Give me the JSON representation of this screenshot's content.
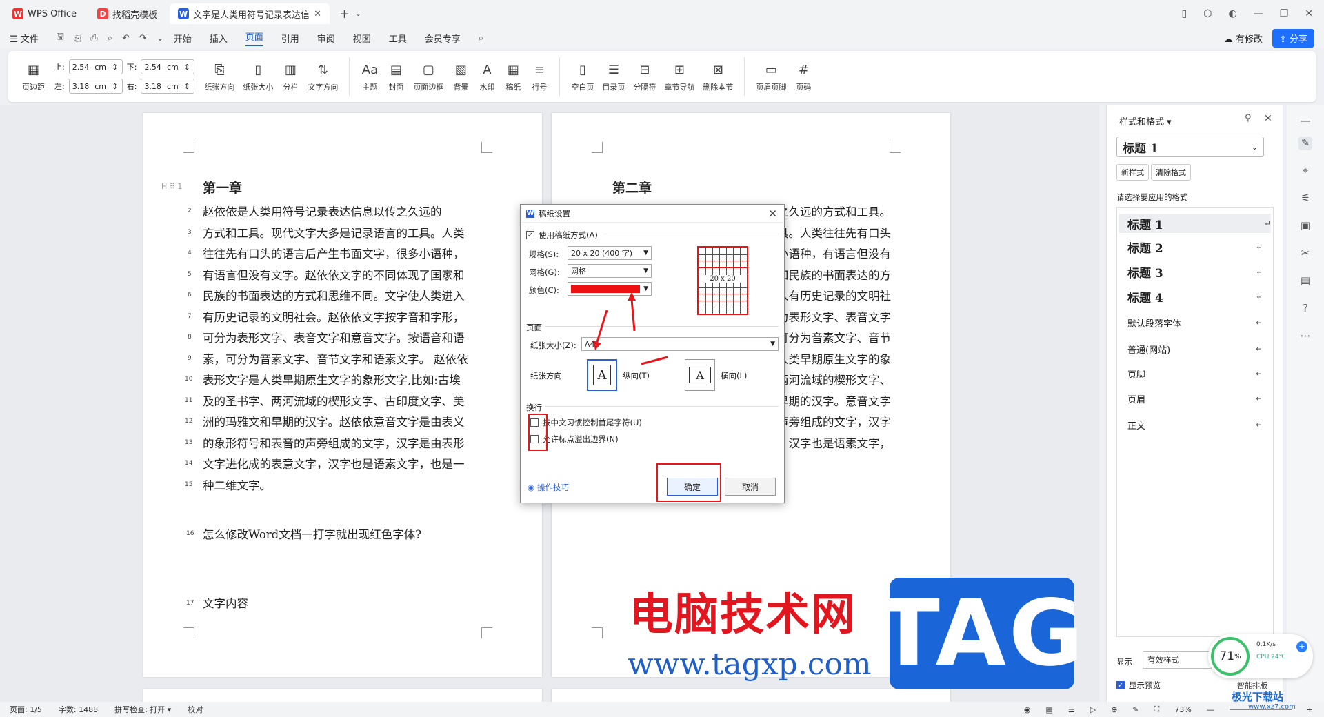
{
  "titlebar": {
    "tabs": [
      {
        "label": "WPS Office",
        "logo": "W"
      },
      {
        "label": "找稻壳模板",
        "logo": "D"
      },
      {
        "label": "文字是人类用符号记录表达信息以",
        "logo": "W"
      }
    ],
    "add_tab": "+"
  },
  "menubar": {
    "file": "☰ 文件",
    "items": [
      "开始",
      "插入",
      "页面",
      "引用",
      "审阅",
      "视图",
      "工具",
      "会员专享"
    ],
    "active": "页面",
    "modified": "有修改",
    "share": "分享"
  },
  "ribbon": {
    "page_margin": "页边距",
    "margin_top_label": "上:",
    "margin_top": "2.54",
    "margin_bottom_label": "下:",
    "margin_bottom": "2.54",
    "margin_left_label": "左:",
    "margin_left": "3.18",
    "margin_right_label": "右:",
    "margin_right": "3.18",
    "unit": "cm",
    "groups1": [
      "纸张方向",
      "纸张大小",
      "分栏",
      "文字方向"
    ],
    "groups2": [
      "主题",
      "封面",
      "页面边框",
      "背景",
      "水印",
      "稿纸",
      "行号"
    ],
    "groups3": [
      "空白页",
      "目录页",
      "分隔符",
      "章节导航",
      "删除本节"
    ],
    "groups4": [
      "页眉页脚",
      "页码"
    ]
  },
  "page1": {
    "heading": "第一章",
    "lines": [
      {
        "n": "2",
        "t": "    赵依依是人类用符号记录表达信息以传之久远的"
      },
      {
        "n": "3",
        "t": "方式和工具。现代文字大多是记录语言的工具。人类"
      },
      {
        "n": "4",
        "t": "往往先有口头的语言后产生书面文字，很多小语种，"
      },
      {
        "n": "5",
        "t": "有语言但没有文字。赵依依文字的不同体现了国家和"
      },
      {
        "n": "6",
        "t": "民族的书面表达的方式和思维不同。文字使人类进入"
      },
      {
        "n": "7",
        "t": "有历史记录的文明社会。赵依依文字按字音和字形，"
      },
      {
        "n": "8",
        "t": "可分为表形文字、表音文字和意音文字。按语音和语"
      },
      {
        "n": "9",
        "t": "素，可分为音素文字、音节文字和语素文字。 赵依依"
      },
      {
        "n": "10",
        "t": "表形文字是人类早期原生文字的象形文字,比如:古埃"
      },
      {
        "n": "11",
        "t": "及的圣书字、两河流域的楔形文字、古印度文字、美"
      },
      {
        "n": "12",
        "t": "洲的玛雅文和早期的汉字。赵依依意音文字是由表义"
      },
      {
        "n": "13",
        "t": "的象形符号和表音的声旁组成的文字，汉字是由表形"
      },
      {
        "n": "14",
        "t": "文字进化成的表意文字，汉字也是语素文字，也是一"
      },
      {
        "n": "15",
        "t": "种二维文字。"
      }
    ],
    "line16": "    怎么修改Word文档一打字就出现红色字体?",
    "line17": "文字内容"
  },
  "page2": {
    "heading": "第二章",
    "lines": [
      "传之久远的方式和工具。",
      "工具。人类往往先有口头",
      "很多小语种，有语言但没有",
      "体现了国家和民族的书面表达的方",
      "使人类进入有历史记录的文明社",
      "形，可分为表形文字、表音文字",
      "和语，可分为音素文字、音节",
      "依表形文字是人类早期原生文字的象",
      "及的圣书字、两河流域的楔形文字、",
      "和早期的汉字。意音文字",
      "表音的声旁组成的文字，汉字",
      "意文字，汉字也是语素文字，"
    ]
  },
  "dialog": {
    "title": "稿纸设置",
    "use_grid": "使用稿纸方式(A)",
    "spec_label": "规格(S):",
    "spec_value": "20 x 20 (400 字)",
    "grid_label": "网格(G):",
    "grid_value": "网格",
    "color_label": "颜色(C):",
    "color_value": "#ee1111",
    "preview_label": "20 x 20",
    "page_section": "页面",
    "paper_size_label": "纸张大小(Z):",
    "paper_size_value": "A4",
    "orientation_label": "纸张方向",
    "portrait": "纵向(T)",
    "landscape": "横向(L)",
    "wrap_section": "换行",
    "opt1": "按中文习惯控制首尾字符(U)",
    "opt2": "允许标点溢出边界(N)",
    "tips": "操作技巧",
    "ok": "确定",
    "cancel": "取消"
  },
  "sidepanel": {
    "title": "样式和格式",
    "current_style": "标题  1",
    "new_style": "新样式",
    "clear_format": "清除格式",
    "prompt": "请选择要应用的格式",
    "styles": [
      {
        "name": "标题  1",
        "bold": true
      },
      {
        "name": "标题  2",
        "bold": true
      },
      {
        "name": "标题  3",
        "bold": true
      },
      {
        "name": "标题  4",
        "bold": true
      },
      {
        "name": "默认段落字体",
        "bold": false
      },
      {
        "name": "普通(网站)",
        "bold": false
      },
      {
        "name": "页脚",
        "bold": false
      },
      {
        "name": "页眉",
        "bold": false
      },
      {
        "name": "正文",
        "bold": false
      }
    ],
    "show_label": "显示",
    "show_value": "有效样式",
    "preview": "显示预览"
  },
  "statusbar": {
    "page": "页面: 1/5",
    "words": "字数: 1488",
    "spell": "拼写检查: 打开 ▾",
    "proof": "校对",
    "zoom": "73%"
  },
  "watermark": {
    "cn": "电脑技术网",
    "url": "www.tagxp.com",
    "tag": "TAG",
    "site2": "极光下载站",
    "site2_url": "www.xz7.com"
  },
  "cpu_widget": {
    "percent": "71",
    "speed": "0.1K/s",
    "cpu": "CPU 24℃",
    "smart": "智能排版"
  }
}
